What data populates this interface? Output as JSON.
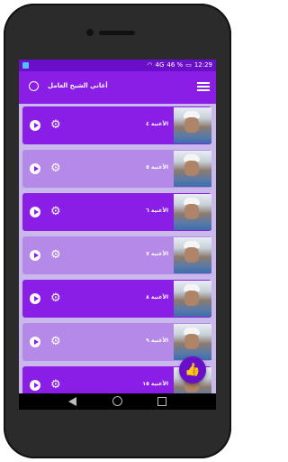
{
  "status": {
    "signal": "4G",
    "battery": "46 %",
    "time": "12:29"
  },
  "appbar": {
    "title": "أغاني الشيخ العامل"
  },
  "songs": [
    {
      "label": "الأغنية ٤",
      "style": "dark"
    },
    {
      "label": "الأغنية ٥",
      "style": "light"
    },
    {
      "label": "الأغنية ٦",
      "style": "dark"
    },
    {
      "label": "الأغنية ٧",
      "style": "light"
    },
    {
      "label": "الأغنية ٨",
      "style": "dark"
    },
    {
      "label": "الأغنية ٩",
      "style": "light"
    },
    {
      "label": "الأغنية ١٥",
      "style": "dark"
    }
  ],
  "colors": {
    "primary": "#8a1ee6",
    "primary_dark": "#6a0fc9",
    "row_light": "#b589e8"
  }
}
